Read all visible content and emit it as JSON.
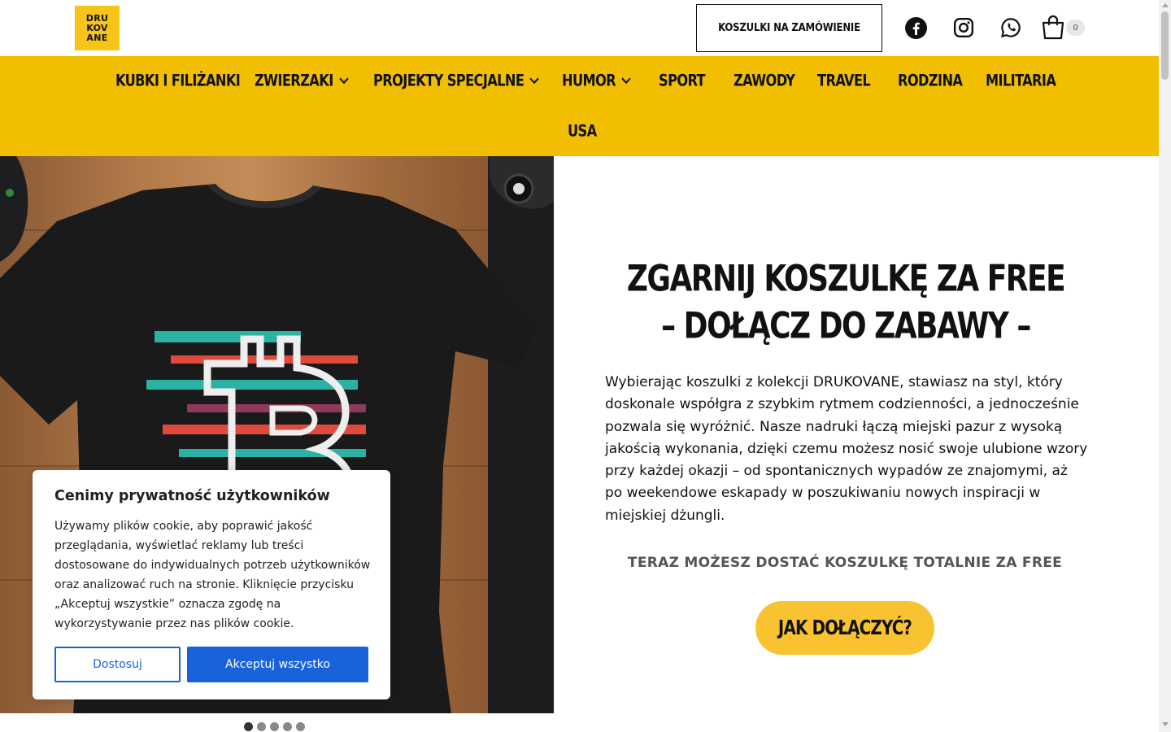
{
  "header": {
    "logo_lines": [
      "DRU",
      "KOV",
      "ANE"
    ],
    "order_button": "KOSZULKI NA ZAMÓWIENIE",
    "social_icons": [
      "facebook-icon",
      "instagram-icon",
      "whatsapp-icon"
    ],
    "cart_count": "0"
  },
  "nav": {
    "items": [
      {
        "label": "KUBKI I FILIŻANKI",
        "dropdown": false
      },
      {
        "label": "ZWIERZAKI",
        "dropdown": true
      },
      {
        "label": "PROJEKTY SPECJALNE",
        "dropdown": true
      },
      {
        "label": "HUMOR",
        "dropdown": true
      },
      {
        "label": "SPORT",
        "dropdown": false
      },
      {
        "label": "ZAWODY",
        "dropdown": false
      },
      {
        "label": "TRAVEL",
        "dropdown": false
      },
      {
        "label": "RODZINA",
        "dropdown": false
      },
      {
        "label": "MILITARIA",
        "dropdown": false
      },
      {
        "label": "USA",
        "dropdown": false
      }
    ]
  },
  "hero": {
    "title_line1": "ZGARNIJ KOSZULKĘ ZA FREE",
    "title_line2": "– DOŁĄCZ DO ZABAWY –",
    "body": "Wybierając koszulki z kolekcji DRUKOVANE, stawiasz na styl, który doskonale współgra z szybkim rytmem codzienności, a jednocześnie pozwala się wyróżnić. Nasze nadruki łączą miejski pazur z wysoką jakością wykonania, dzięki czemu możesz nosić swoje ulubione wzory przy każdej okazji – od spontanicznych wypadów ze znajomymi, aż po weekendowe eskapady w poszukiwaniu nowych inspiracji w miejskiej dżungli.",
    "subheading": "TERAZ MOŻESZ DOSTAĆ KOSZULKĘ TOTALNIE ZA FREE",
    "cta": "JAK DOŁĄCZYĆ?"
  },
  "slider": {
    "dot_count": 5,
    "active_index": 0
  },
  "cookie": {
    "title": "Cenimy prywatność użytkowników",
    "text": "Używamy plików cookie, aby poprawić jakość przeglądania, wyświetlać reklamy lub treści dostosowane do indywidualnych potrzeb użytkowników oraz analizować ruch na stronie. Kliknięcie przycisku „Akceptuj wszystkie” oznacza zgodę na wykorzystywanie przez nas plików cookie.",
    "customize": "Dostosuj",
    "accept": "Akceptuj wszystko"
  },
  "colors": {
    "brand_yellow": "#f2bf00",
    "cta_yellow": "#f9c230",
    "cookie_blue": "#1863dc"
  }
}
